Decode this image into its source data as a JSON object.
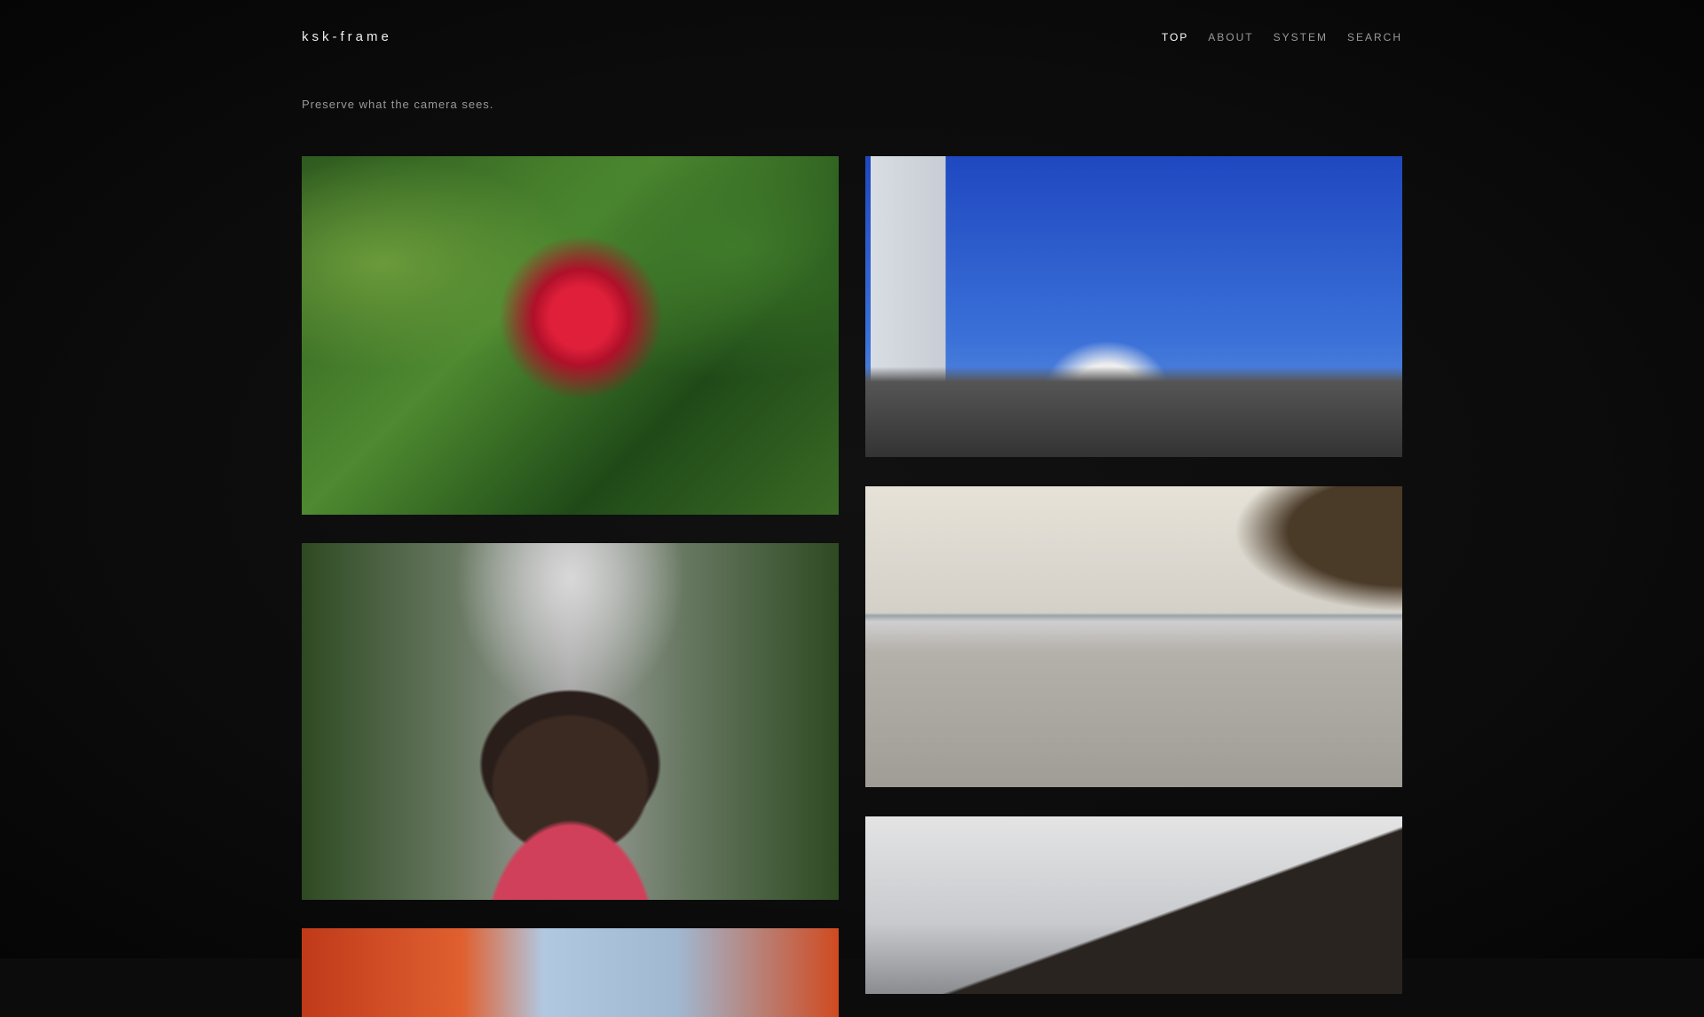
{
  "header": {
    "logo": "ksk-frame",
    "nav": [
      {
        "label": "TOP",
        "active": true
      },
      {
        "label": "ABOUT"
      },
      {
        "label": "SYSTEM"
      },
      {
        "label": "SEARCH"
      }
    ]
  },
  "tagline": "Preserve what the camera sees.",
  "photos": [
    {
      "icon": "photo-red-bromeliad-flower"
    },
    {
      "icon": "photo-sailing-ship-harbor"
    },
    {
      "icon": "photo-beach-parasol"
    },
    {
      "icon": "photo-girl-strawberry-greenhouse"
    },
    {
      "icon": "photo-temple-roof"
    },
    {
      "icon": "photo-autumn-leaves"
    }
  ]
}
